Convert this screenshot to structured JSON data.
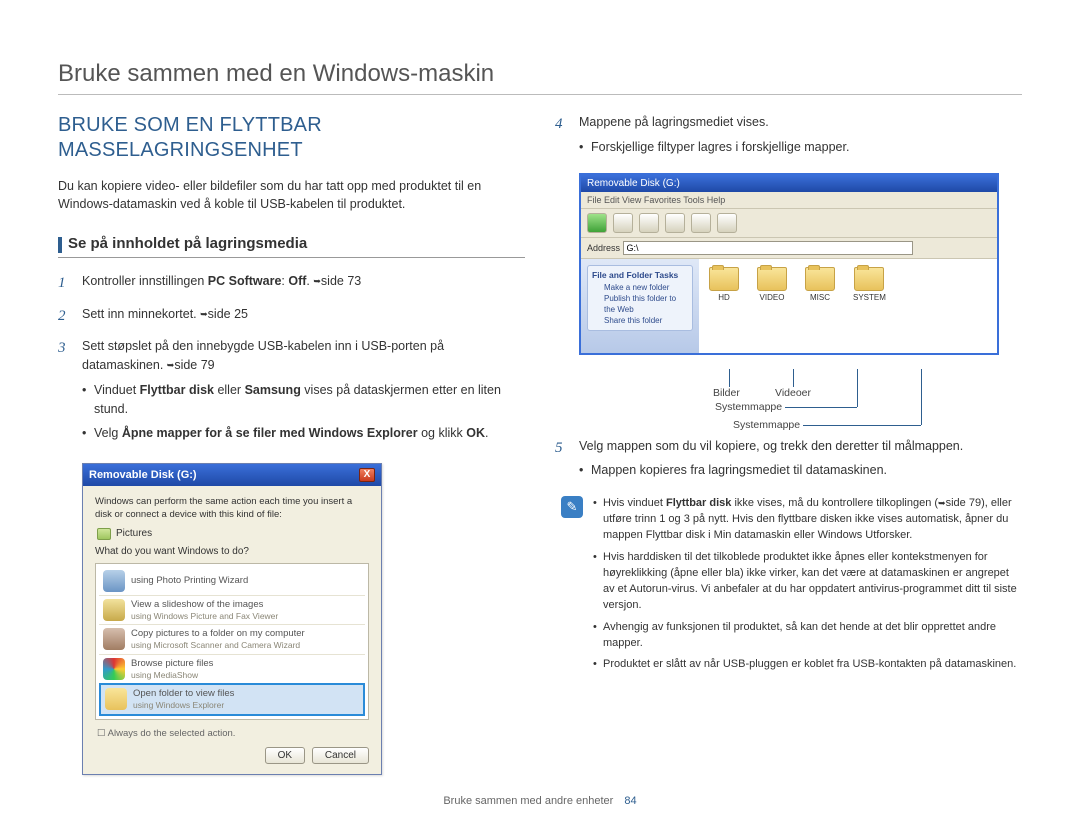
{
  "page_title": "Bruke sammen med en Windows-maskin",
  "left": {
    "heading": "BRUKE SOM EN FLYTTBAR MASSELAGRINGSENHET",
    "intro": "Du kan kopiere video- eller bildefiler som du har tatt opp med produktet til en Windows-datamaskin ved å koble til USB-kabelen til produktet.",
    "subhead": "Se på innholdet på lagringsmedia",
    "steps": {
      "s1": {
        "num": "1",
        "t1": "Kontroller innstillingen ",
        "b1": "PC Software",
        "t2": ": ",
        "b2": "Off",
        "t3": ". ",
        "ref": "side 73"
      },
      "s2": {
        "num": "2",
        "t1": "Sett inn minnekortet. ",
        "ref": "side 25"
      },
      "s3": {
        "num": "3",
        "t1": "Sett støpslet på den innebygde USB-kabelen inn i USB-porten på datamaskinen. ",
        "ref": "side 79",
        "b1_pre": "Vinduet ",
        "b1": "Flyttbar disk",
        "b1_mid": " eller ",
        "b1b": "Samsung",
        "b1_post": " vises på dataskjermen etter en liten stund.",
        "b2_pre": "Velg ",
        "b2": "Åpne mapper for å se filer med Windows Explorer",
        "b2_mid": " og klikk ",
        "b2b": "OK",
        "b2_post": "."
      }
    },
    "dialog": {
      "title": "Removable Disk (G:)",
      "desc": "Windows can perform the same action each time you insert a disk or connect a device with this kind of file:",
      "pictures": "Pictures",
      "question": "What do you want Windows to do?",
      "a1": "using Photo Printing Wizard",
      "a2": "View a slideshow of the images",
      "a2s": "using Windows Picture and Fax Viewer",
      "a3": "Copy pictures to a folder on my computer",
      "a3s": "using Microsoft Scanner and Camera Wizard",
      "a4": "Browse picture files",
      "a4s": "using MediaShow",
      "a5": "Open folder to view files",
      "a5s": "using Windows Explorer",
      "always": "Always do the selected action.",
      "ok": "OK",
      "cancel": "Cancel"
    }
  },
  "right": {
    "s4": {
      "num": "4",
      "t1": "Mappene på lagringsmediet vises.",
      "b1": "Forskjellige filtyper lagres i forskjellige mapper."
    },
    "explorer": {
      "title": "Removable Disk (G:)",
      "menu": "File   Edit   View   Favorites   Tools   Help",
      "addr_label": "Address",
      "addr_value": "G:\\",
      "side_header": "File and Folder Tasks",
      "side_l1": "Make a new folder",
      "side_l2": "Publish this folder to the Web",
      "side_l3": "Share this folder",
      "folders": [
        "HD",
        "VIDEO",
        "MISC",
        "SYSTEM"
      ]
    },
    "callout_bilder": "Bilder",
    "callout_videoer": "Videoer",
    "callout_sys1": "Systemmappe",
    "callout_sys2": "Systemmappe",
    "s5": {
      "num": "5",
      "t1": "Velg mappen som du vil kopiere, og trekk den deretter til målmappen.",
      "b1": "Mappen kopieres fra lagringsmediet til datamaskinen."
    },
    "note": {
      "n1_pre": "Hvis vinduet ",
      "n1_b": "Flyttbar disk",
      "n1_post": " ikke vises, må du kontrollere tilkoplingen (",
      "n1_ref": "side 79",
      "n1_post2": "), eller utføre trinn 1 og 3 på nytt. Hvis den flyttbare disken ikke vises automatisk, åpner du mappen Flyttbar disk i Min datamaskin eller Windows Utforsker.",
      "n2": "Hvis harddisken til det tilkoblede produktet ikke åpnes eller kontekstmenyen for høyreklikking (åpne eller bla) ikke virker, kan det være at datamaskinen er angrepet av et Autorun-virus. Vi anbefaler at du har oppdatert antivirus-programmet ditt til siste versjon.",
      "n3": "Avhengig av funksjonen til produktet, så kan det hende at det blir opprettet andre mapper.",
      "n4": "Produktet er slått av når USB-pluggen er koblet fra USB-kontakten på datamaskinen."
    }
  },
  "footer": {
    "text": "Bruke sammen med andre enheter",
    "page": "84"
  }
}
